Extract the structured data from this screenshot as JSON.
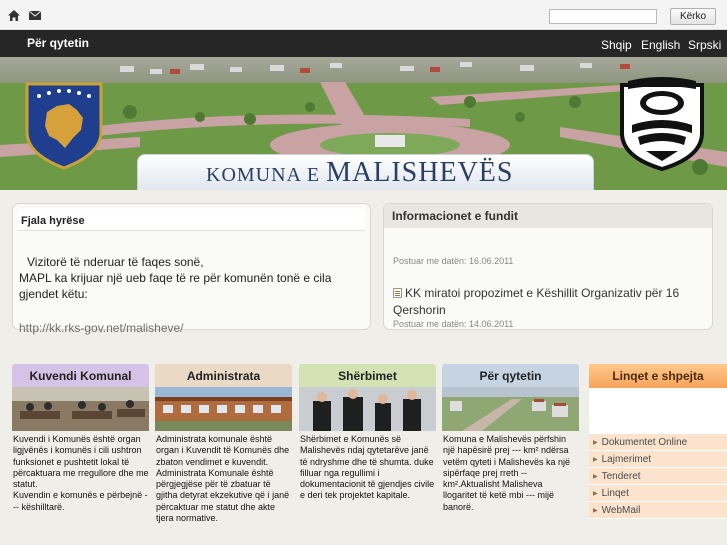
{
  "topbar": {
    "search": {
      "placeholder": "",
      "button_label": "Kërko"
    }
  },
  "nav": {
    "left_label": "Për qytetin",
    "languages": [
      "Shqip",
      "English",
      "Srpski"
    ]
  },
  "banner": {
    "title": "Komuna e Malishevës"
  },
  "welcome": {
    "title": "Fjala hyrëse",
    "line1": "Vizitorë të nderuar të faqes sonë,",
    "line2": "MAPL ka krijuar një ueb faqe të re për komunën tonë e cila gjendet këtu:",
    "link": "http://kk.rks-gov.net/malisheve/"
  },
  "news": {
    "title": "Informacionet e fundit",
    "items": [
      {
        "title": "",
        "date": "Postuar me datën: 16.06.2011"
      },
      {
        "title": "KK miratoi propozimet e Këshillit Organizativ për 16 Qershorin",
        "date": "Postuar me datën: 14.06.2011"
      }
    ]
  },
  "columns": [
    {
      "title": "Kuvendi Komunal",
      "text": "Kuvendi i Komunës është organ ligjvënës i komunës i cili ushtron funksionet e pushtetit lokal të përcaktuara me rregullore dhe me statut.\nKuvendin e komunës e përbejnë --- këshilltarë.",
      "tab_color": "#d4c3e6"
    },
    {
      "title": "Administrata",
      "text": "Administrata komunale është organ i Kuvendit të Komunës dhe zbaton vendimet e kuvendit. Administrata Komunale është përgjegjëse për të zbatuar të gjitha detyrat ekzekutive që i janë përcaktuar me statut dhe akte tjera normative.",
      "tab_color": "#e9d9c5"
    },
    {
      "title": "Shërbimet",
      "text": "Shërbimet e Komunës së Malishevës ndaj qytetarëve janë të ndryshme dhe të shumta. duke filluar nga regullimi i dokumentacionit të gjendjes civile e deri tek projektet kapitale.",
      "tab_color": "#d2e2b3"
    },
    {
      "title": "Për qytetin",
      "text": "Komuna e Malishevës përfshin një hapësirë prej --- km² ndërsa vetëm qyteti i Malishevës ka një sipërfaqe prej rreth -- km².Aktualisht Malisheva llogaritet të ketë mbi --- mijë banorë.",
      "tab_color": "#c6d3e3"
    }
  ],
  "quick_links": {
    "title": "Linqet e shpejta",
    "items": [
      "Dokumentet Online",
      "Lajmerimet",
      "Tenderet",
      "Linqet",
      "WebMail"
    ]
  },
  "colors": {
    "nav_background": "#262626",
    "content_background": "#efeee9",
    "quick_links_tab": "#f7a45a",
    "quick_links_item": "#fbe3cd",
    "title_text": "#2b3f66"
  }
}
